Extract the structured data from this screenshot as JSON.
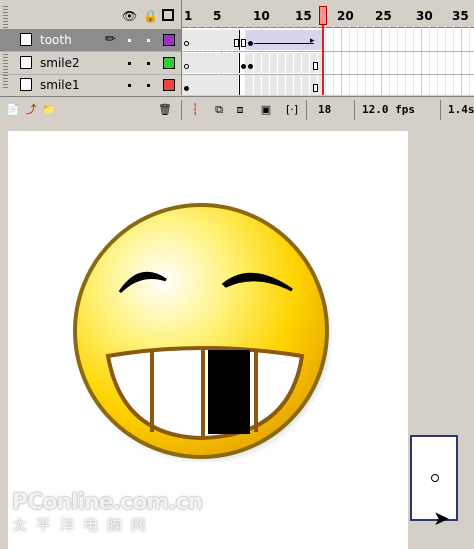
{
  "layers": [
    {
      "name": "tooth",
      "selected": true,
      "color": "#9933cc"
    },
    {
      "name": "smile2",
      "selected": false,
      "color": "#33cc33"
    },
    {
      "name": "smile1",
      "selected": false,
      "color": "#ee4444"
    }
  ],
  "ruler": {
    "labels": [
      "1",
      "5",
      "10",
      "15",
      "20",
      "25",
      "30",
      "35"
    ]
  },
  "toolbar": {
    "current_frame": "18",
    "fps": "12.0 fps",
    "elapsed": "1.4s"
  },
  "watermark": {
    "line1": "PConline.com.cn",
    "line2": "太 平 洋 电 脑 网"
  },
  "colors": {
    "accent_playhead": "#ff9090",
    "stage_bg": "#ffffff",
    "face_yellow": "#ffd400"
  }
}
